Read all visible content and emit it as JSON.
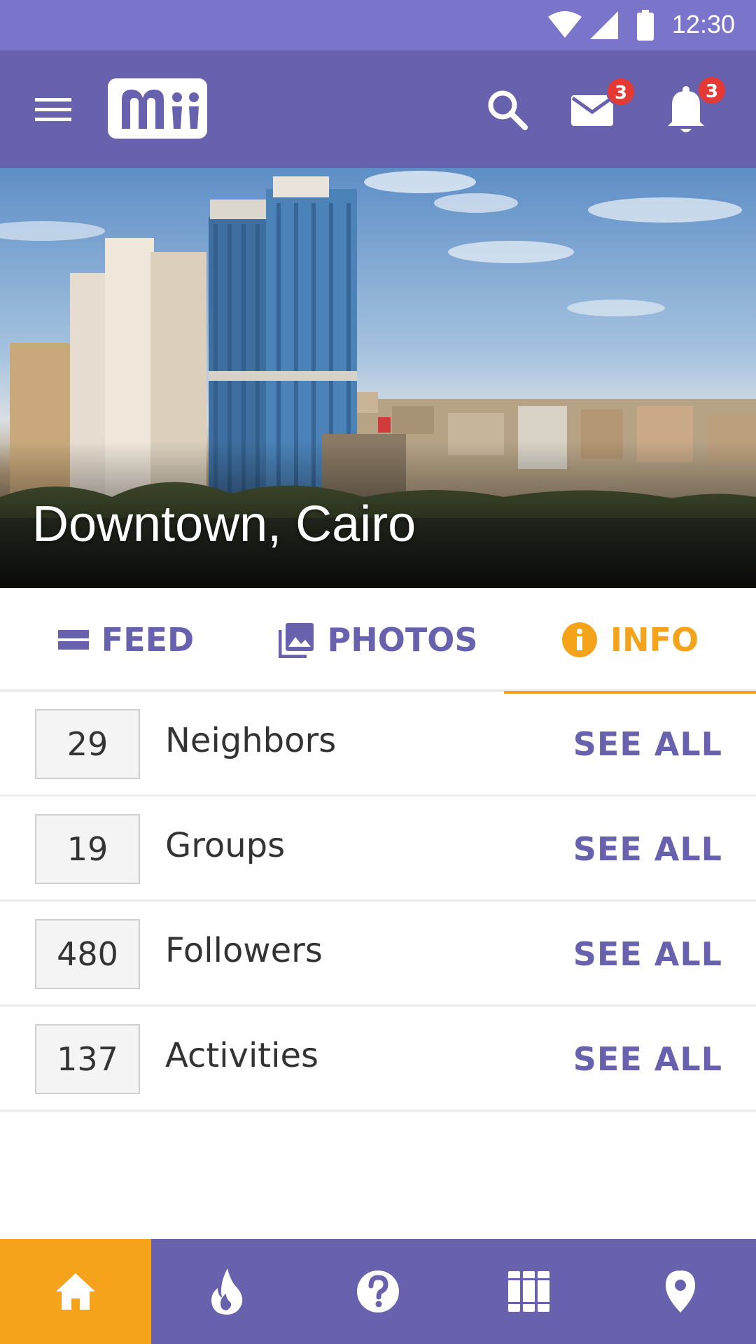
{
  "status_bar": {
    "time": "12:30"
  },
  "app_bar": {
    "logo_text": "Mii",
    "mail_badge": "3",
    "notification_badge": "3"
  },
  "hero": {
    "title": "Downtown, Cairo"
  },
  "tabs": [
    {
      "label": "FEED",
      "icon": "feed-icon",
      "active": false
    },
    {
      "label": "PHOTOS",
      "icon": "photos-icon",
      "active": false
    },
    {
      "label": "INFO",
      "icon": "info-icon",
      "active": true
    }
  ],
  "stats": [
    {
      "count": "29",
      "label": "Neighbors",
      "action": "SEE ALL"
    },
    {
      "count": "19",
      "label": "Groups",
      "action": "SEE ALL"
    },
    {
      "count": "480",
      "label": "Followers",
      "action": "SEE ALL"
    },
    {
      "count": "137",
      "label": "Activities",
      "action": "SEE ALL"
    }
  ],
  "bottom_nav": [
    {
      "icon": "home-icon",
      "active": true
    },
    {
      "icon": "fire-icon",
      "active": false
    },
    {
      "icon": "help-icon",
      "active": false
    },
    {
      "icon": "library-icon",
      "active": false
    },
    {
      "icon": "location-pin-icon",
      "active": false
    }
  ],
  "colors": {
    "primary": "#6861ae",
    "status_bar": "#7b74cb",
    "accent": "#f5a31b",
    "badge": "#e53935"
  }
}
